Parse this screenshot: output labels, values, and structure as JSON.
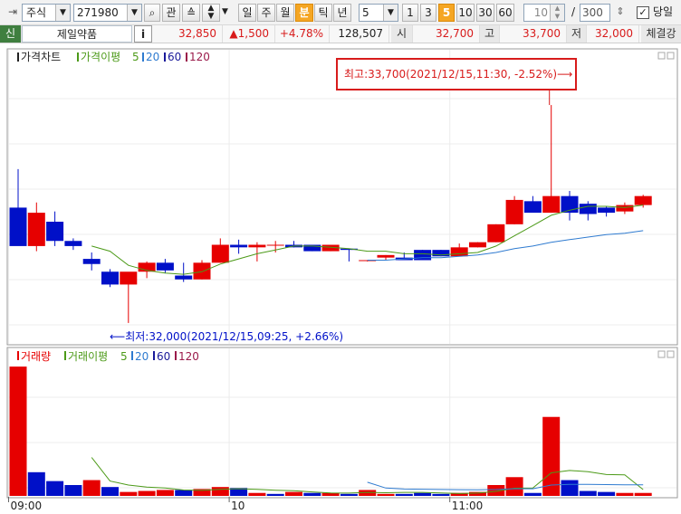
{
  "toolbar": {
    "market": "주식",
    "code": "271980",
    "btn_gwan": "관",
    "periods": [
      "일",
      "주",
      "월",
      "분",
      "틱",
      "년"
    ],
    "active_period": "분",
    "interval_value": "5",
    "intervals": [
      "1",
      "3",
      "5",
      "10",
      "30",
      "60"
    ],
    "active_interval": "5",
    "count_small": "10",
    "count_sep": "/",
    "count_total": "300",
    "today_label": "당일",
    "today_checked": true
  },
  "quote": {
    "badge": "신",
    "name": "제일약품",
    "info_btn": "i",
    "price": "32,850",
    "change": "▲1,500",
    "change_pct": "+4.78%",
    "volume": "128,507",
    "open_label": "시",
    "open": "32,700",
    "high_label": "고",
    "high": "33,700",
    "low_label": "저",
    "low": "32,000",
    "contract_label": "체결강"
  },
  "price_pane": {
    "legend_title": "가격차트",
    "legend_ma": "가격이평",
    "legend_periods": [
      "5",
      "20",
      "60",
      "120"
    ],
    "high_note": "최고:33,700(2021/12/15,11:30, -2.52%)⟶",
    "low_note": "⟵최저:32,000(2021/12/15,09:25, +2.66%)"
  },
  "volume_pane": {
    "legend_title": "거래량",
    "legend_ma": "거래이평",
    "legend_periods": [
      "5",
      "20",
      "60",
      "120"
    ]
  },
  "x_axis": {
    "labels": [
      "09:00",
      "10",
      "11:00"
    ]
  },
  "colors": {
    "up": "#e60000",
    "down": "#0010c8",
    "ma5": "#4c9a18",
    "ma20": "#2f7bd0",
    "ma60": "#1a1a9a",
    "ma120": "#9a1a4a",
    "annotation_box": "#d81b1b"
  },
  "chart_data": {
    "type": "candlestick",
    "interval": "5 min",
    "date": "2021/12/15",
    "candles": [
      {
        "o": 32900,
        "h": 33200,
        "l": 32650,
        "c": 32600
      },
      {
        "o": 32600,
        "h": 32940,
        "l": 32560,
        "c": 32860
      },
      {
        "o": 32790,
        "h": 32870,
        "l": 32600,
        "c": 32640
      },
      {
        "o": 32640,
        "h": 32660,
        "l": 32570,
        "c": 32600
      },
      {
        "o": 32500,
        "h": 32550,
        "l": 32410,
        "c": 32460
      },
      {
        "o": 32400,
        "h": 32420,
        "l": 32280,
        "c": 32300
      },
      {
        "o": 32300,
        "h": 32380,
        "l": 32000,
        "c": 32400
      },
      {
        "o": 32400,
        "h": 32480,
        "l": 32350,
        "c": 32470
      },
      {
        "o": 32470,
        "h": 32500,
        "l": 32390,
        "c": 32410
      },
      {
        "o": 32370,
        "h": 32470,
        "l": 32320,
        "c": 32340
      },
      {
        "o": 32340,
        "h": 32490,
        "l": 32340,
        "c": 32470
      },
      {
        "o": 32470,
        "h": 32660,
        "l": 32470,
        "c": 32610
      },
      {
        "o": 32610,
        "h": 32650,
        "l": 32540,
        "c": 32590
      },
      {
        "o": 32590,
        "h": 32630,
        "l": 32480,
        "c": 32610
      },
      {
        "o": 32610,
        "h": 32640,
        "l": 32550,
        "c": 32610
      },
      {
        "o": 32610,
        "h": 32640,
        "l": 32590,
        "c": 32590
      },
      {
        "o": 32610,
        "h": 32610,
        "l": 32560,
        "c": 32560
      },
      {
        "o": 32560,
        "h": 32610,
        "l": 32560,
        "c": 32610
      },
      {
        "o": 32580,
        "h": 32580,
        "l": 32480,
        "c": 32570
      },
      {
        "o": 32490,
        "h": 32490,
        "l": 32480,
        "c": 32490
      },
      {
        "o": 32510,
        "h": 32530,
        "l": 32490,
        "c": 32530
      },
      {
        "o": 32510,
        "h": 32550,
        "l": 32490,
        "c": 32490
      },
      {
        "o": 32570,
        "h": 32570,
        "l": 32490,
        "c": 32490
      },
      {
        "o": 32570,
        "h": 32570,
        "l": 32520,
        "c": 32520
      },
      {
        "o": 32520,
        "h": 32620,
        "l": 32520,
        "c": 32590
      },
      {
        "o": 32590,
        "h": 32630,
        "l": 32590,
        "c": 32630
      },
      {
        "o": 32630,
        "h": 32770,
        "l": 32630,
        "c": 32770
      },
      {
        "o": 32770,
        "h": 32990,
        "l": 32770,
        "c": 32960
      },
      {
        "o": 32950,
        "h": 32990,
        "l": 32870,
        "c": 32860
      },
      {
        "o": 32860,
        "h": 33700,
        "l": 32860,
        "c": 32990
      },
      {
        "o": 32990,
        "h": 33030,
        "l": 32800,
        "c": 32860
      },
      {
        "o": 32930,
        "h": 32950,
        "l": 32800,
        "c": 32850
      },
      {
        "o": 32900,
        "h": 32910,
        "l": 32830,
        "c": 32860
      },
      {
        "o": 32870,
        "h": 32940,
        "l": 32850,
        "c": 32920
      },
      {
        "o": 32920,
        "h": 33000,
        "l": 32900,
        "c": 32990
      }
    ],
    "ma5": [
      null,
      null,
      null,
      null,
      32600,
      32560,
      32450,
      32410,
      32390,
      32380,
      32400,
      32460,
      32500,
      32540,
      32570,
      32600,
      32600,
      32590,
      32580,
      32560,
      32560,
      32540,
      32540,
      32530,
      32540,
      32550,
      32600,
      32680,
      32760,
      32840,
      32880,
      32910,
      32910,
      32900,
      32920
    ],
    "ma20": [
      null,
      null,
      null,
      null,
      null,
      null,
      null,
      null,
      null,
      null,
      null,
      null,
      null,
      null,
      null,
      null,
      null,
      null,
      null,
      32490,
      32490,
      32500,
      32510,
      32510,
      32520,
      32530,
      32550,
      32580,
      32600,
      32630,
      32650,
      32670,
      32690,
      32700,
      32720
    ],
    "volume": [
      13100,
      2400,
      1500,
      1100,
      1600,
      900,
      400,
      500,
      600,
      600,
      700,
      900,
      800,
      300,
      200,
      400,
      300,
      300,
      200,
      600,
      200,
      200,
      300,
      200,
      300,
      400,
      1100,
      1900,
      300,
      8000,
      1600,
      500,
      400,
      300,
      300
    ],
    "volume_up": [
      true,
      false,
      false,
      false,
      true,
      false,
      true,
      true,
      true,
      false,
      true,
      true,
      false,
      true,
      false,
      true,
      false,
      true,
      false,
      true,
      true,
      false,
      false,
      false,
      true,
      true,
      true,
      true,
      false,
      true,
      false,
      false,
      false,
      true,
      true
    ],
    "vol_ma5": [
      null,
      null,
      null,
      null,
      3900,
      1500,
      1100,
      900,
      800,
      600,
      560,
      660,
      720,
      660,
      580,
      520,
      400,
      300,
      280,
      360,
      320,
      360,
      360,
      300,
      240,
      280,
      460,
      780,
      800,
      2340,
      2580,
      2460,
      2160,
      2140,
      640
    ],
    "vol_ma20": [
      null,
      null,
      null,
      null,
      null,
      null,
      null,
      null,
      null,
      null,
      null,
      null,
      null,
      null,
      null,
      null,
      null,
      null,
      null,
      1380,
      800,
      700,
      680,
      650,
      630,
      620,
      650,
      720,
      720,
      1100,
      1160,
      1160,
      1150,
      1130,
      1130
    ],
    "ylim_price": [
      31950,
      33750
    ],
    "ylim_volume": [
      0,
      13200
    ],
    "x_ticks": [
      {
        "index": 0,
        "label": "09:00"
      },
      {
        "index": 12,
        "label": "10"
      },
      {
        "index": 24,
        "label": "11:00"
      }
    ],
    "high_point": {
      "index": 29,
      "price": 33700
    },
    "low_point": {
      "index": 6,
      "price": 32000
    }
  }
}
